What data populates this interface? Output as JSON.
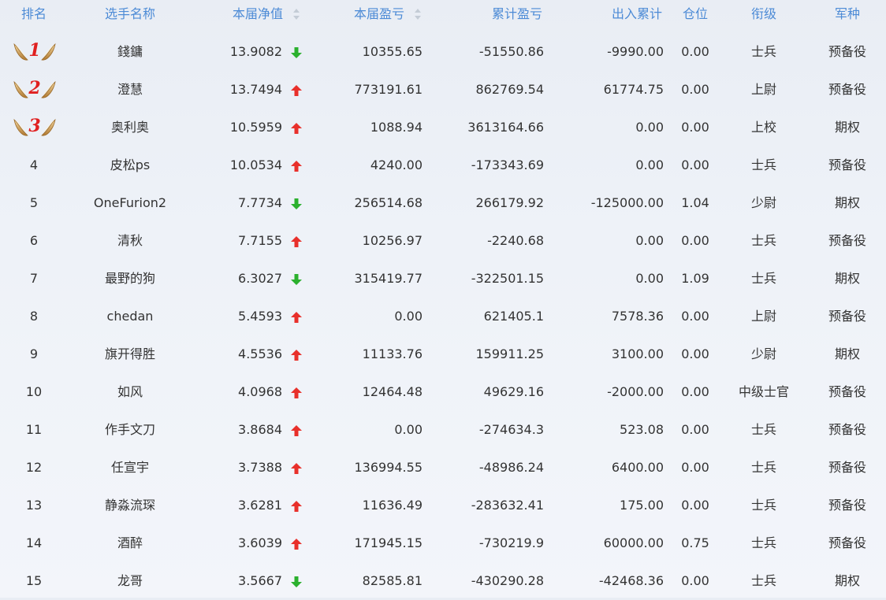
{
  "columns": {
    "rank": "排名",
    "name": "选手名称",
    "nav": "本届净值",
    "pnl": "本届盈亏",
    "cum_pnl": "累计盈亏",
    "flow": "出入累计",
    "position": "仓位",
    "grade": "衔级",
    "branch": "军种"
  },
  "colors": {
    "header": "#4d8bd6",
    "up": "#e8302b",
    "down": "#2bb02e",
    "medal_text": "#e02020"
  },
  "rows": [
    {
      "rank": "1",
      "medal": true,
      "name": "錢鏞",
      "nav": "13.9082",
      "trend": "down",
      "pnl": "10355.65",
      "cum_pnl": "-51550.86",
      "flow": "-9990.00",
      "position": "0.00",
      "grade": "士兵",
      "branch": "预备役"
    },
    {
      "rank": "2",
      "medal": true,
      "name": "澄慧",
      "nav": "13.7494",
      "trend": "up",
      "pnl": "773191.61",
      "cum_pnl": "862769.54",
      "flow": "61774.75",
      "position": "0.00",
      "grade": "上尉",
      "branch": "预备役"
    },
    {
      "rank": "3",
      "medal": true,
      "name": "奥利奥",
      "nav": "10.5959",
      "trend": "up",
      "pnl": "1088.94",
      "cum_pnl": "3613164.66",
      "flow": "0.00",
      "position": "0.00",
      "grade": "上校",
      "branch": "期权"
    },
    {
      "rank": "4",
      "medal": false,
      "name": "皮松ps",
      "nav": "10.0534",
      "trend": "up",
      "pnl": "4240.00",
      "cum_pnl": "-173343.69",
      "flow": "0.00",
      "position": "0.00",
      "grade": "士兵",
      "branch": "预备役"
    },
    {
      "rank": "5",
      "medal": false,
      "name": "OneFurion2",
      "nav": "7.7734",
      "trend": "down",
      "pnl": "256514.68",
      "cum_pnl": "266179.92",
      "flow": "-125000.00",
      "position": "1.04",
      "grade": "少尉",
      "branch": "期权"
    },
    {
      "rank": "6",
      "medal": false,
      "name": "清秋",
      "nav": "7.7155",
      "trend": "up",
      "pnl": "10256.97",
      "cum_pnl": "-2240.68",
      "flow": "0.00",
      "position": "0.00",
      "grade": "士兵",
      "branch": "预备役"
    },
    {
      "rank": "7",
      "medal": false,
      "name": "最野的狗",
      "nav": "6.3027",
      "trend": "down",
      "pnl": "315419.77",
      "cum_pnl": "-322501.15",
      "flow": "0.00",
      "position": "1.09",
      "grade": "士兵",
      "branch": "期权"
    },
    {
      "rank": "8",
      "medal": false,
      "name": "chedan",
      "nav": "5.4593",
      "trend": "up",
      "pnl": "0.00",
      "cum_pnl": "621405.1",
      "flow": "7578.36",
      "position": "0.00",
      "grade": "上尉",
      "branch": "预备役"
    },
    {
      "rank": "9",
      "medal": false,
      "name": "旗开得胜",
      "nav": "4.5536",
      "trend": "up",
      "pnl": "11133.76",
      "cum_pnl": "159911.25",
      "flow": "3100.00",
      "position": "0.00",
      "grade": "少尉",
      "branch": "期权"
    },
    {
      "rank": "10",
      "medal": false,
      "name": "如风",
      "nav": "4.0968",
      "trend": "up",
      "pnl": "12464.48",
      "cum_pnl": "49629.16",
      "flow": "-2000.00",
      "position": "0.00",
      "grade": "中级士官",
      "branch": "预备役"
    },
    {
      "rank": "11",
      "medal": false,
      "name": "作手文刀",
      "nav": "3.8684",
      "trend": "up",
      "pnl": "0.00",
      "cum_pnl": "-274634.3",
      "flow": "523.08",
      "position": "0.00",
      "grade": "士兵",
      "branch": "预备役"
    },
    {
      "rank": "12",
      "medal": false,
      "name": "任宣宇",
      "nav": "3.7388",
      "trend": "up",
      "pnl": "136994.55",
      "cum_pnl": "-48986.24",
      "flow": "6400.00",
      "position": "0.00",
      "grade": "士兵",
      "branch": "预备役"
    },
    {
      "rank": "13",
      "medal": false,
      "name": "静淼流琛",
      "nav": "3.6281",
      "trend": "up",
      "pnl": "11636.49",
      "cum_pnl": "-283632.41",
      "flow": "175.00",
      "position": "0.00",
      "grade": "士兵",
      "branch": "预备役"
    },
    {
      "rank": "14",
      "medal": false,
      "name": "酒醉",
      "nav": "3.6039",
      "trend": "up",
      "pnl": "171945.15",
      "cum_pnl": "-730219.9",
      "flow": "60000.00",
      "position": "0.75",
      "grade": "士兵",
      "branch": "预备役"
    },
    {
      "rank": "15",
      "medal": false,
      "name": "龙哥",
      "nav": "3.5667",
      "trend": "down",
      "pnl": "82585.81",
      "cum_pnl": "-430290.28",
      "flow": "-42468.36",
      "position": "0.00",
      "grade": "士兵",
      "branch": "期权"
    }
  ]
}
